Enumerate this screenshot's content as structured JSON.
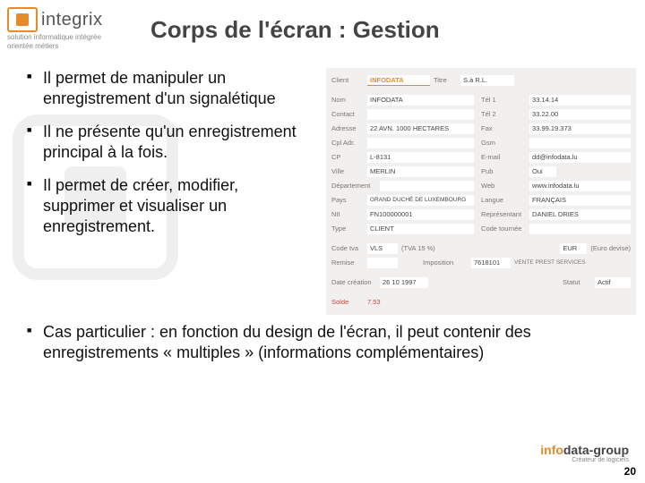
{
  "header": {
    "logo_text": "integrix",
    "logo_sub1": "solution informatique intégrée",
    "logo_sub2": "orientée métiers",
    "title": "Corps de l'écran : Gestion"
  },
  "bullets": [
    "Il permet de manipuler un enregistrement d'un signalétique",
    "Il ne présente qu'un enregistrement principal à la fois.",
    "Il permet de créer, modifier, supprimer et visualiser un enregistrement."
  ],
  "bottom_bullet": "Cas particulier : en fonction du design de l'écran, il peut contenir des enregistrements « multiples » (informations complémentaires)",
  "form": {
    "client_lab": "Client",
    "client_val": "INFODATA",
    "titre_lab": "Titre",
    "titre_val": "S.à R.L.",
    "nom_lab": "Nom",
    "nom_val": "INFODATA",
    "tel1_lab": "Tél 1",
    "tel1_val": "33.14.14",
    "contact_lab": "Contact",
    "contact_val": "",
    "tel2_lab": "Tél 2",
    "tel2_val": "33.22.00",
    "adresse_lab": "Adresse",
    "adresse_val": "22 AVN. 1000 HECTARES",
    "fax_lab": "Fax",
    "fax_val": "33.99.19.373",
    "cpl_lab": "Cpl Adr.",
    "cpl_val": "",
    "gsm_lab": "Gsm",
    "gsm_val": "",
    "cp_lab": "CP",
    "cp_val": "L-8131",
    "email_lab": "E-mail",
    "email_val": "dd@infodata.lu",
    "ville_lab": "Ville",
    "ville_val": "MERLIN",
    "pub_lab": "Pub",
    "pub_val": "Oui",
    "dep_lab": "Département",
    "dep_val": "",
    "web_lab": "Web",
    "web_val": "www.infodata.lu",
    "pays_lab": "Pays",
    "pays_val": "GRAND DUCHÉ DE LUXEMBOURG",
    "langue_lab": "Langue",
    "langue_val": "FRANÇAIS",
    "nii_lab": "NII",
    "nii_val": "FN100000001",
    "rep_lab": "Représentant",
    "rep_val": "DANIEL DRIES",
    "type_lab": "Type",
    "type_val": "CLIENT",
    "code_lab": "Code tournée",
    "code_val": "",
    "tva_lab": "Code tva",
    "tva_val": "VLS",
    "tva_note": "(TVA 15 %)",
    "dev_lab_val": "EUR",
    "dev_note": "(Euro devise)",
    "rem_lab": "Remise",
    "rem_val": "",
    "imp_lab": "Imposition",
    "imp_val": "7618101",
    "imp_note": "VENTE PREST SERVICES",
    "date_lab": "Date création",
    "date_val": "26 10 1997",
    "statut_lab": "Statut",
    "statut_val": "Actif",
    "solde_lab": "Solde",
    "solde_val": "7.53"
  },
  "footer": {
    "brand_info": "info",
    "brand_data": "data",
    "brand_group": "-group",
    "brand_sub": "Créateur de logiciels",
    "page": "20"
  }
}
